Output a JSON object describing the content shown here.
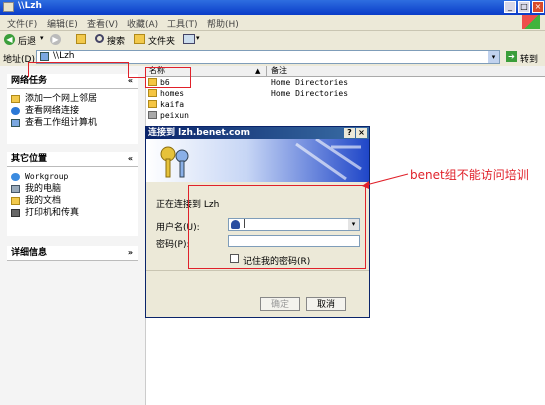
{
  "window": {
    "title": "\\\\Lzh"
  },
  "menu": [
    "文件(F)",
    "编辑(E)",
    "查看(V)",
    "收藏(A)",
    "工具(T)",
    "帮助(H)"
  ],
  "toolbar": {
    "back": "后退",
    "search": "搜索",
    "folders": "文件夹"
  },
  "address": {
    "label": "地址(D)",
    "value": "\\\\Lzh",
    "go": "转到"
  },
  "left": {
    "network": {
      "title": "网络任务",
      "items": [
        "添加一个网上邻居",
        "查看网络连接",
        "查看工作组计算机"
      ]
    },
    "other": {
      "title": "其它位置",
      "items": [
        "Workgroup",
        "我的电脑",
        "我的文档",
        "打印机和传真"
      ]
    },
    "details": {
      "title": "详细信息"
    }
  },
  "list": {
    "headers": {
      "name": "名称",
      "comment": "备注"
    },
    "rows": [
      {
        "name": "b6",
        "comment": "Home Directories"
      },
      {
        "name": "homes",
        "comment": "Home Directories"
      },
      {
        "name": "kaifa",
        "comment": ""
      },
      {
        "name": "peixun",
        "comment": ""
      }
    ]
  },
  "dialog": {
    "title": "连接到 lzh.benet.com",
    "connecting": "正在连接到 Lzh",
    "username_label": "用户名(U):",
    "username_value": "|",
    "password_label": "密码(P):",
    "remember": "记住我的密码(R)",
    "ok": "确定",
    "cancel": "取消"
  },
  "annotation": "benet组不能访问培训",
  "colors": {
    "annotation_red": "#e0212a",
    "xp_blue": "#0a3cc8"
  }
}
